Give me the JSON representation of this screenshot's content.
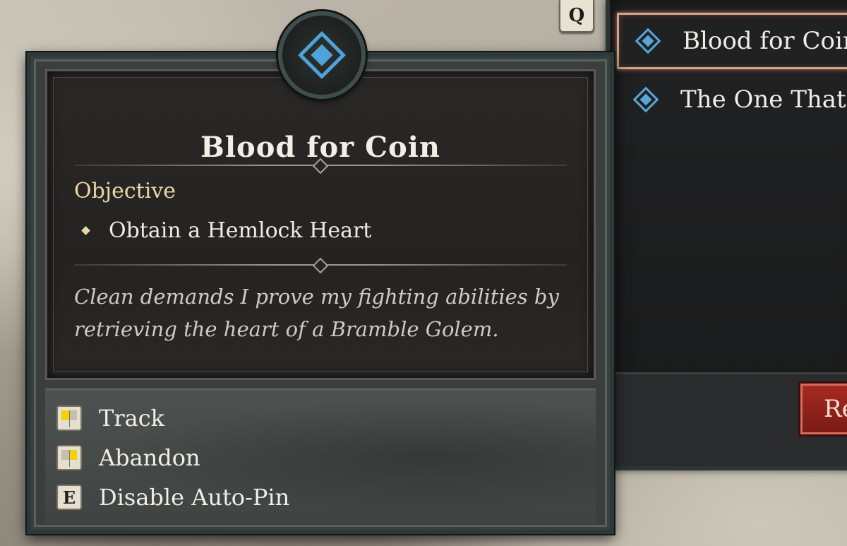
{
  "hotkey_q": "Q",
  "quest_list": {
    "items": [
      {
        "label": "Blood for Coin",
        "selected": true
      },
      {
        "label": "The One That G",
        "selected": false
      }
    ],
    "reward_button_label": "Re"
  },
  "tooltip": {
    "title": "Blood for Coin",
    "objective_heading": "Objective",
    "objective": "Obtain a Hemlock Heart",
    "description": "Clean demands I prove my fighting abilities by retrieving the heart of a Bramble Golem."
  },
  "actions": [
    {
      "key": "mouse-left",
      "label": "Track"
    },
    {
      "key": "mouse-right",
      "label": "Abandon"
    },
    {
      "key": "E",
      "label": "Disable Auto-Pin"
    }
  ],
  "colors": {
    "quest_icon": "#4fa2da",
    "objective_heading": "#e7d9a4",
    "selection_border": "#c9a690",
    "reward_button": "#a52a23"
  }
}
